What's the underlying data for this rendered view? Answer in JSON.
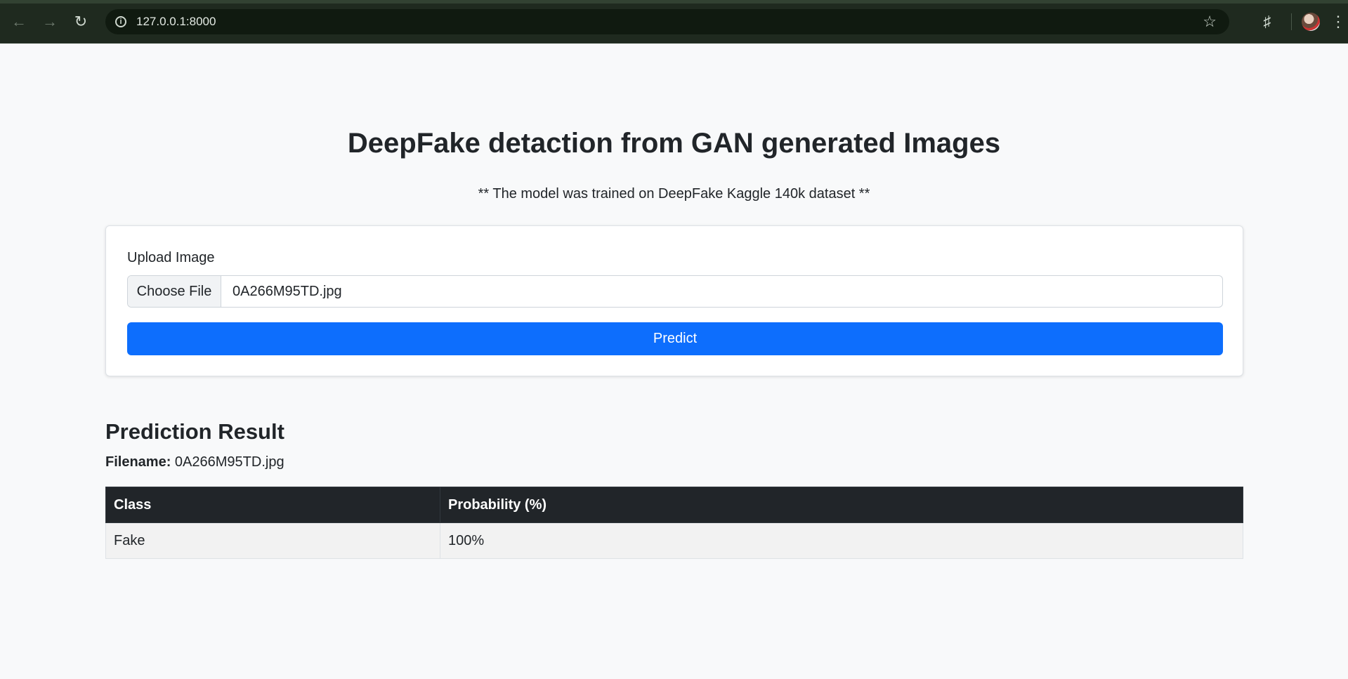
{
  "browser": {
    "url": "127.0.0.1:8000",
    "icons": {
      "back": "arrow-left-icon",
      "forward": "arrow-right-icon",
      "reload": "reload-icon",
      "info": "info-icon",
      "bookmark": "star-icon",
      "extensions": "puzzle-icon",
      "menu": "kebab-menu-icon"
    }
  },
  "header": {
    "title": "DeepFake detaction from GAN generated Images",
    "subtitle": "** The model was trained on DeepFake Kaggle 140k dataset **"
  },
  "upload": {
    "label": "Upload Image",
    "choose_file_label": "Choose File",
    "file_name": "0A266M95TD.jpg",
    "predict_label": "Predict"
  },
  "result": {
    "heading": "Prediction Result",
    "filename_label": "Filename:",
    "filename_value": "0A266M95TD.jpg",
    "columns": [
      "Class",
      "Probability (%)"
    ],
    "rows": [
      {
        "class": "Fake",
        "probability": "100%"
      }
    ]
  },
  "colors": {
    "primary_button": "#0d6efd",
    "table_header": "#212529",
    "page_background": "#f8f9fa",
    "browser_chrome": "#1f2a1f"
  }
}
